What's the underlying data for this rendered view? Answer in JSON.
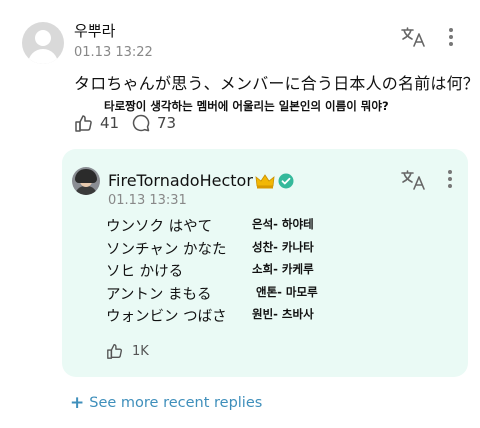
{
  "post": {
    "author": "우뿌라",
    "time": "01.13 13:22",
    "text": "タロちゃんが思う、メンバーに合う日本人の名前は何？",
    "translation": "타로짱이 생각하는 멤버에 어울리는 일본인의 이름이 뭐야?",
    "likes": "41",
    "comments": "73"
  },
  "reply": {
    "author": "FireTornadoHector",
    "time": "01.13 13:31",
    "names_jp": [
      "ウンソク はやて",
      "ソンチャン かなた",
      "ソヒ かける",
      "アントン まもる",
      "ウォンビン つばさ"
    ],
    "names_kr": [
      "은석- 하야테",
      "성찬- 카나타",
      "소희- 카케루",
      "앤톤- 마모루",
      "원빈- 츠바사"
    ],
    "likes": "1K"
  },
  "see_more": "See more recent replies",
  "icons": {
    "translate": "translate-icon",
    "more": "more-vertical-icon",
    "like": "like-icon",
    "comment": "comment-icon",
    "crown": "crown-icon",
    "verified": "verified-icon"
  },
  "colors": {
    "reply_background": "#eafaf5",
    "link": "#3f8fbb",
    "verified": "#35b99b",
    "crown": "#f2b705"
  }
}
